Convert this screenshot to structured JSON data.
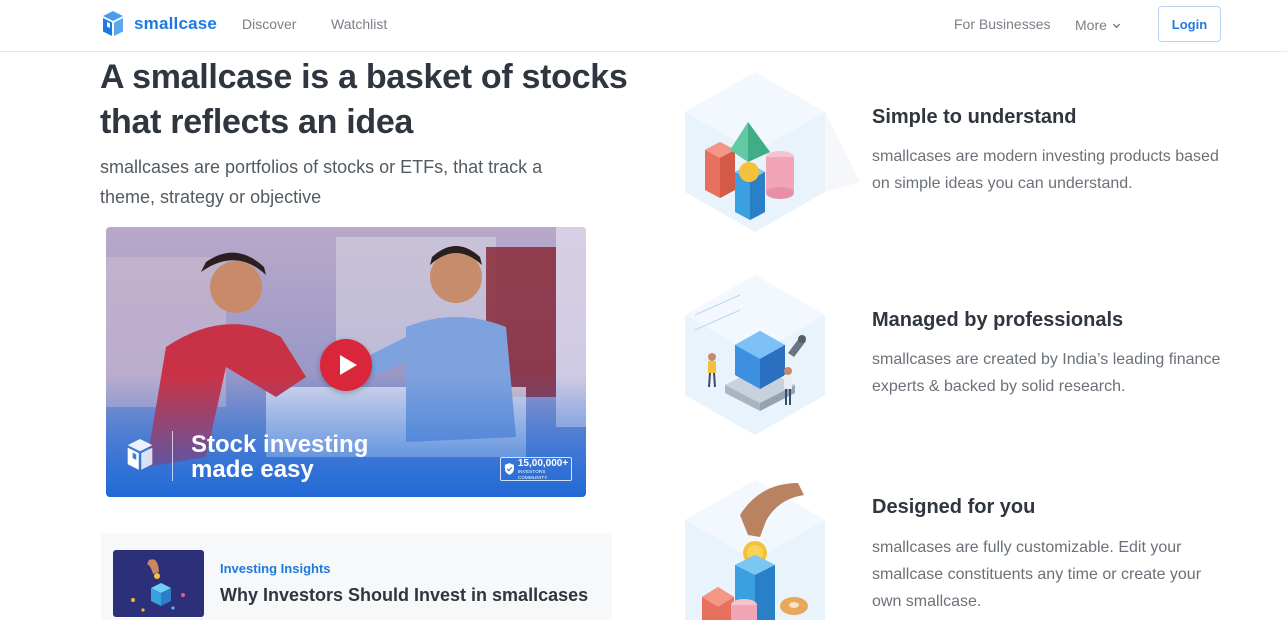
{
  "header": {
    "brand": "smallcase",
    "nav": {
      "discover": "Discover",
      "watchlist": "Watchlist",
      "for_businesses": "For Businesses",
      "more": "More"
    },
    "login": "Login"
  },
  "hero": {
    "title": "A smallcase is a basket of stocks that reflects an idea",
    "subtitle": "smallcases are portfolios of stocks or ETFs, that track a theme, strategy or objective"
  },
  "video": {
    "caption": "Stock investing made easy",
    "badge_count": "15,00,000+",
    "badge_label": "INVESTORS COMMUNITY",
    "icons": [
      "play-icon",
      "smallcase-logo-icon",
      "shield-icon"
    ]
  },
  "insight": {
    "kicker": "Investing Insights",
    "title": "Why Investors Should Invest in smallcases"
  },
  "features": [
    {
      "title": "Simple to understand",
      "desc": "smallcases are modern investing products based on simple ideas you can understand."
    },
    {
      "title": "Managed by professionals",
      "desc": "smallcases are created by India’s leading finance experts & backed by solid research."
    },
    {
      "title": "Designed for you",
      "desc": "smallcases are fully customizable. Edit your smallcase constituents any time or create your own smallcase."
    }
  ],
  "colors": {
    "brand_blue": "#1f7ae0",
    "text_dark": "#2f363f",
    "play_red": "#d9263a"
  }
}
